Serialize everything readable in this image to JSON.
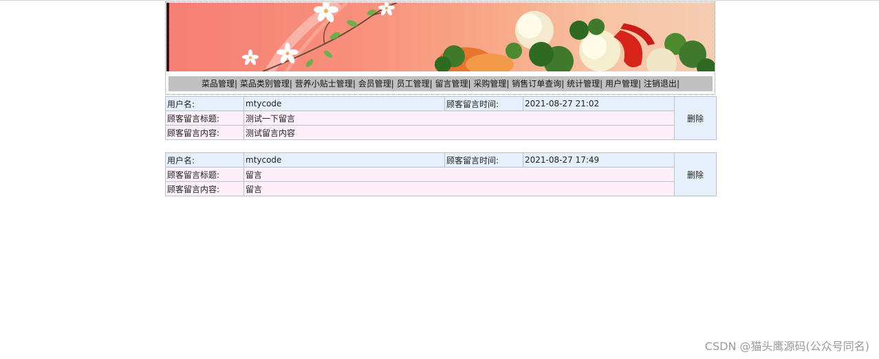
{
  "nav": {
    "items": [
      "菜品管理",
      "菜品类别管理",
      "营养小贴士管理",
      "会员管理",
      "员工管理",
      "留言管理",
      "采购管理",
      "销售订单查询",
      "统计管理",
      "用户管理",
      "注销退出"
    ],
    "separator": "|"
  },
  "messages": [
    {
      "username_label": "用户名:",
      "username": "mtycode",
      "time_label": "顾客留言时间:",
      "time": "2021-08-27 21:02",
      "title_label": "顾客留言标题:",
      "title": "测试一下留言",
      "content_label": "顾客留言内容:",
      "content": "测试留言内容",
      "delete_label": "删除"
    },
    {
      "username_label": "用户名:",
      "username": "mtycode",
      "time_label": "顾客留言时间:",
      "time": "2021-08-27 17:49",
      "title_label": "顾客留言标题:",
      "title": "留言",
      "content_label": "顾客留言内容:",
      "content": "留言",
      "delete_label": "删除"
    }
  ],
  "watermark": "CSDN @猫头鹰源码(公众号同名)",
  "colors": {
    "nav_bg": "#c0c0c0",
    "row_blue": "#e6f0fb",
    "row_pink": "#fdf0fb",
    "banner_left": "#f57f74",
    "banner_right": "#f5cdb3"
  }
}
